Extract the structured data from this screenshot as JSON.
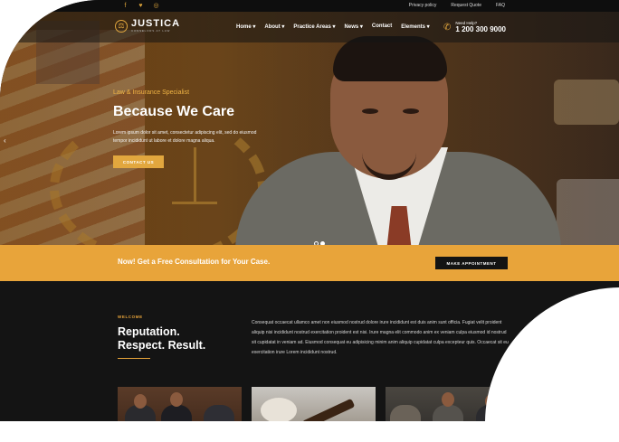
{
  "topbar": {
    "social_icons": [
      "facebook-icon",
      "twitter-icon",
      "instagram-icon"
    ],
    "links": [
      "Privacy policy",
      "Request Quote",
      "FAQ"
    ]
  },
  "header": {
    "logo_name": "JUSTICA",
    "logo_tagline": "CONSELORS AT LAW",
    "nav": [
      "Home",
      "About",
      "Practice Areas",
      "News",
      "Contact",
      "Elements"
    ],
    "help_label": "Need Help?",
    "help_number": "1 200 300 9000"
  },
  "hero": {
    "subtitle": "Law & Insurance Specialist",
    "title": "Because We Care",
    "description": "Lorem ipsum dolor sit amet, consectetur adipiscing elit, sed do eiusmod tempor incididunt ut labore et dolore magna aliqua.",
    "button": "CONTACT US",
    "slides": 2,
    "active_slide": 2
  },
  "cta": {
    "text": "Now! Get a Free Consultation for Your Case.",
    "button": "MAKE APPOINTMENT"
  },
  "welcome": {
    "tag": "WELCOME",
    "title_line1": "Reputation.",
    "title_line2": "Respect. Result.",
    "body": "Consequat occaecat ullamco amet non eiusmod nostrud dolore irure incididunt est duis anim sunt officia. Fugiat velit proident aliquip nisi incididunt nostrud exercitation proident est nisi. Irure magna elit commodo anim ex veniam culpa eiusmod id nostrud sit cupidatat in veniam ad. Eiusmod consequat eu adipisicing minim anim aliquip cupidatat culpa excepteur quis. Occaecat sit eu exercitation irure Lorem incididunt nostrud."
  },
  "colors": {
    "accent": "#e8a43a",
    "dark": "#141414"
  }
}
